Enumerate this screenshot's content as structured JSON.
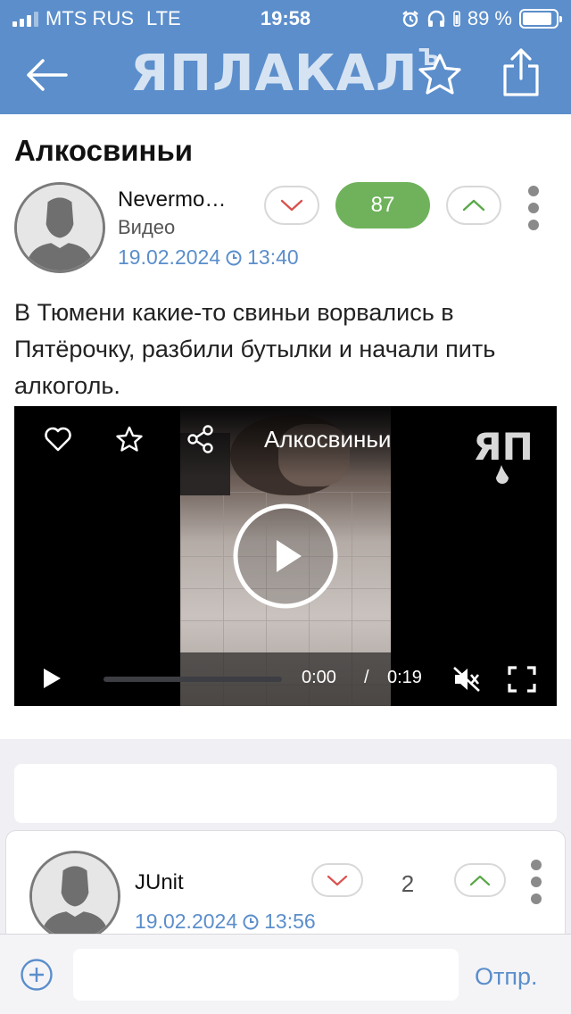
{
  "status_bar": {
    "carrier": "MTS RUS",
    "network": "LTE",
    "time": "19:58",
    "battery": "89 %",
    "battery_level": 0.89
  },
  "navbar": {
    "logo_text": "ЯПЛАКАЛ",
    "logo_suffix": "Ъ",
    "icons": [
      "back-arrow-icon",
      "star-icon",
      "share-icon"
    ]
  },
  "post": {
    "title": "Алкосвиньи",
    "author": "Nevermo…",
    "category": "Видео",
    "date": "19.02.2024",
    "time": "13:40",
    "score": "87",
    "text": "В Тюмени какие-то свиньи ворвались в Пятёрочку, разбили бутылки и начали пить алкоголь."
  },
  "video": {
    "title": "Алкосвиньи",
    "current_time": "0:00",
    "separator": "/",
    "duration": "0:19",
    "progress": 0,
    "watermark": "ЯП"
  },
  "comment": {
    "author": "JUnit",
    "date": "19.02.2024",
    "time": "13:56",
    "score": "2"
  },
  "composer": {
    "placeholder": "",
    "send_label": "Отпр."
  },
  "colors": {
    "brand_blue": "#5b8ecb",
    "score_green": "#6fb25b",
    "downvote_red": "#d9534f",
    "upvote_green": "#5aa84a"
  }
}
